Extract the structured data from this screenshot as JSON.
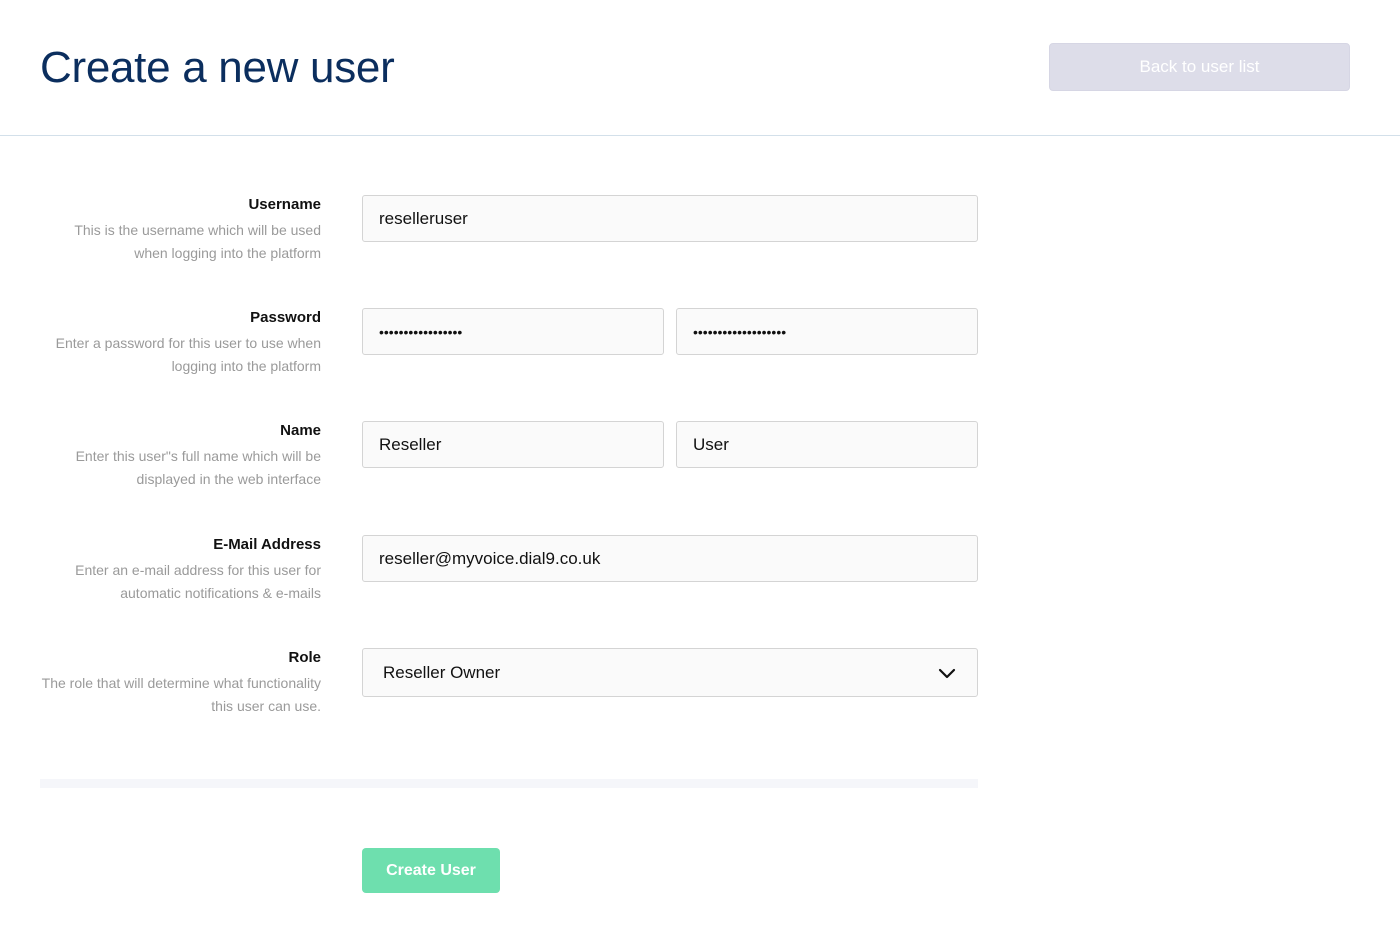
{
  "header": {
    "title": "Create a new user",
    "back_label": "Back to user list"
  },
  "form": {
    "username": {
      "label": "Username",
      "desc": "This is the username which will be used when logging into the platform",
      "value": "reselleruser"
    },
    "password": {
      "label": "Password",
      "desc": "Enter a password for this user to use when logging into the platform",
      "value": "•••••••••••••••••",
      "confirm_value": "•••••••••••••••••••"
    },
    "name": {
      "label": "Name",
      "desc": "Enter this user\"s full name which will be displayed in the web interface",
      "first": "Reseller",
      "last": "User"
    },
    "email": {
      "label": "E-Mail Address",
      "desc": "Enter an e-mail address for this user for automatic notifications & e-mails",
      "value": "reseller@myvoice.dial9.co.uk"
    },
    "role": {
      "label": "Role",
      "desc": "The role that will determine what functionality this user can use.",
      "selected": "Reseller Owner"
    },
    "submit_label": "Create User"
  },
  "icons": {
    "role_dropdown": "chevron-down-icon"
  },
  "colors": {
    "title": "#0b2e5e",
    "back_button": "#dddde9",
    "create_button": "#6edfae"
  }
}
